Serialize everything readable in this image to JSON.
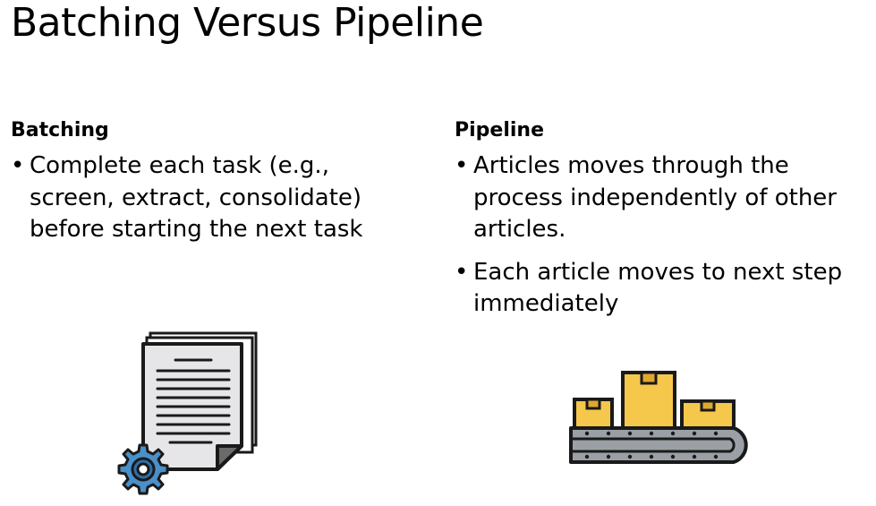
{
  "slide": {
    "title": "Batching Versus Pipeline",
    "left": {
      "heading": "Batching",
      "bullets": [
        "Complete each task (e.g., screen, extract, consolidate) before starting the next task"
      ],
      "icon": "documents-gear-icon"
    },
    "right": {
      "heading": "Pipeline",
      "bullets": [
        "Articles moves through the process independently of other articles.",
        "Each article moves to next step immediately"
      ],
      "icon": "conveyor-belt-boxes-icon"
    },
    "colors": {
      "text": "#000000",
      "paper": "#e6e6e8",
      "outline": "#1a1a1a",
      "gear": "#4a90c8",
      "box": "#f5c84c",
      "belt": "#9aa0a6"
    }
  }
}
